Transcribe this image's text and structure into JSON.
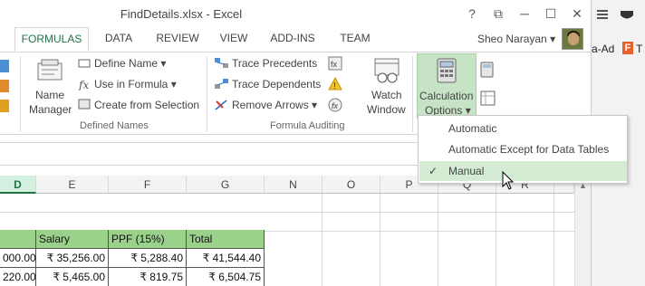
{
  "window": {
    "title": "FindDetails.xlsx - Excel"
  },
  "title_controls": {
    "help": "?",
    "restore_ribbon": "⧉",
    "minimize": "─",
    "maximize": "☐",
    "close": "✕"
  },
  "tabs": [
    {
      "label": "FORMULAS",
      "active": true
    },
    {
      "label": "DATA"
    },
    {
      "label": "REVIEW"
    },
    {
      "label": "VIEW"
    },
    {
      "label": "ADD-INS"
    },
    {
      "label": "TEAM"
    }
  ],
  "user": {
    "name": "Sheo Narayan",
    "chevron": "▾"
  },
  "defined_names": {
    "name_manager_line1": "Name",
    "name_manager_line2": "Manager",
    "define_name": "Define Name",
    "use_in_formula": "Use in Formula",
    "create_from_selection": "Create from Selection",
    "group_label": "Defined Names"
  },
  "formula_auditing": {
    "trace_precedents": "Trace Precedents",
    "trace_dependents": "Trace Dependents",
    "remove_arrows": "Remove Arrows",
    "watch_line1": "Watch",
    "watch_line2": "Window",
    "group_label": "Formula Auditing"
  },
  "calculation": {
    "line1": "Calculation",
    "line2": "Options",
    "chevron": "▾"
  },
  "menu": {
    "items": [
      {
        "label": "Automatic",
        "checked": false
      },
      {
        "label": "Automatic Except for Data Tables",
        "checked": false
      },
      {
        "label": "Manual",
        "checked": true
      }
    ],
    "check_glyph": "✓"
  },
  "columns": [
    "D",
    "E",
    "F",
    "G",
    "N",
    "O",
    "P",
    "Q",
    "R"
  ],
  "table": {
    "headers": [
      "",
      "Salary",
      "PPF (15%)",
      "Total"
    ],
    "rows": [
      [
        "000.00",
        "₹ 35,256.00",
        "₹ 5,288.40",
        "₹ 41,544.40"
      ],
      [
        "220.00",
        "₹ 5,465.00",
        "₹ 819.75",
        "₹ 6,504.75"
      ]
    ]
  },
  "right_app": {
    "text1": "a-Ad",
    "text2": "T"
  },
  "colors": {
    "accent": "#217346",
    "header_fill": "#9bd28b",
    "calc_active": "#c6e3c6"
  }
}
